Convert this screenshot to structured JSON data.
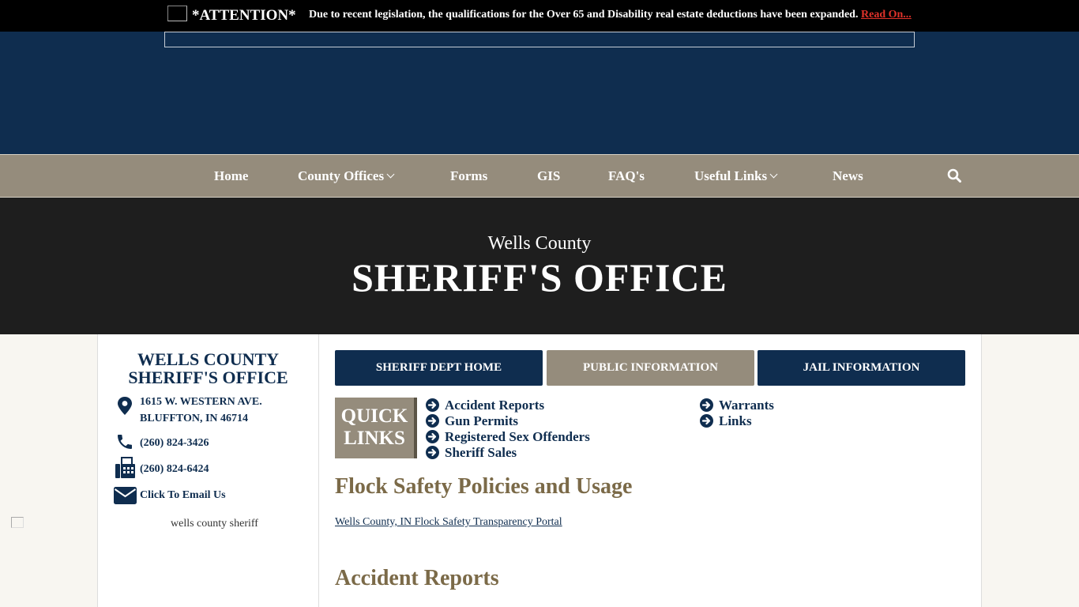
{
  "attention": {
    "title": "*ATTENTION*",
    "message": "Due to recent legislation, the qualifications for the Over 65 and Disability real estate deductions have been expanded.",
    "link": "Read On..."
  },
  "nav": {
    "items": [
      {
        "label": "Home"
      },
      {
        "label": "County Offices",
        "dropdown": true
      },
      {
        "label": "Forms"
      },
      {
        "label": "GIS"
      },
      {
        "label": "FAQ's"
      },
      {
        "label": "Useful Links",
        "dropdown": true
      },
      {
        "label": "News"
      }
    ],
    "search_icon": "search-icon"
  },
  "hero": {
    "subtitle": "Wells County",
    "title": "SHERIFF'S OFFICE"
  },
  "sidebar": {
    "title_line1": "WELLS COUNTY",
    "title_line2": "SHERIFF'S OFFICE",
    "address_line1": "1615 W. WESTERN AVE.",
    "address_line2": "BLUFFTON, IN 46714",
    "phone": "(260) 824-3426",
    "fax": "(260) 824-6424",
    "email_label": "Click To Email Us",
    "image_alt": "wells county sheriff"
  },
  "tabs": [
    {
      "label": "SHERIFF DEPT HOME",
      "active": false
    },
    {
      "label": "PUBLIC INFORMATION",
      "active": true
    },
    {
      "label": "JAIL INFORMATION",
      "active": false
    }
  ],
  "quick_links": {
    "heading_line1": "QUICK",
    "heading_line2": "LINKS",
    "items": [
      "Accident Reports",
      "Gun Permits",
      "Registered Sex Offenders",
      "Sheriff Sales",
      "Warrants",
      "Links"
    ]
  },
  "main": {
    "section1_title": "Flock Safety Policies and Usage",
    "portal_link": "Wells County, IN Flock Safety Transparency Portal",
    "section2_title": "Accident Reports"
  },
  "colors": {
    "navy": "#0f2d4f",
    "tan": "#958c7c",
    "hero_bg": "#1e1e1e",
    "heading_brown": "#7b6a48",
    "alert_red": "#e0322a"
  }
}
